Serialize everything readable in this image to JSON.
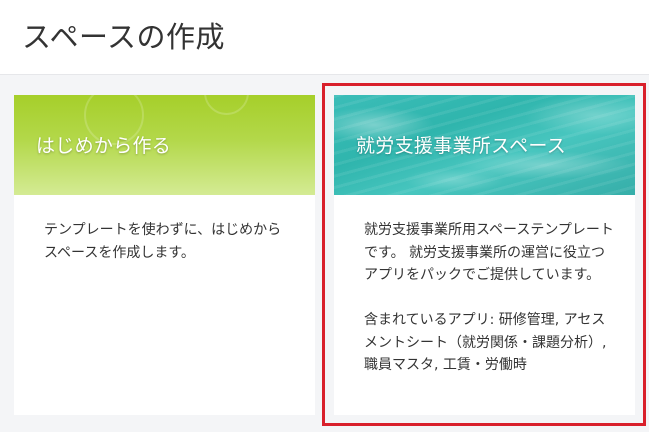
{
  "header": {
    "title": "スペースの作成"
  },
  "cards": [
    {
      "banner_title": "はじめから作る",
      "description": "テンプレートを使わずに、はじめからスペースを作成します。",
      "banner_color": "#a6cf2a",
      "selected": false
    },
    {
      "banner_title": "就労支援事業所スペース",
      "description": "就労支援事業所用スペーステンプレートです。 就労支援事業所の運営に役立つアプリをパックでご提供しています。\n\n含まれているアプリ: 研修管理, アセスメントシート（就労関係・課題分析）, 職員マスタ, 工賃・労働時",
      "banner_color": "#3bbdb8",
      "selected": true
    }
  ],
  "colors": {
    "selection_border": "#d9202b",
    "page_background": "#f4f5f7"
  }
}
